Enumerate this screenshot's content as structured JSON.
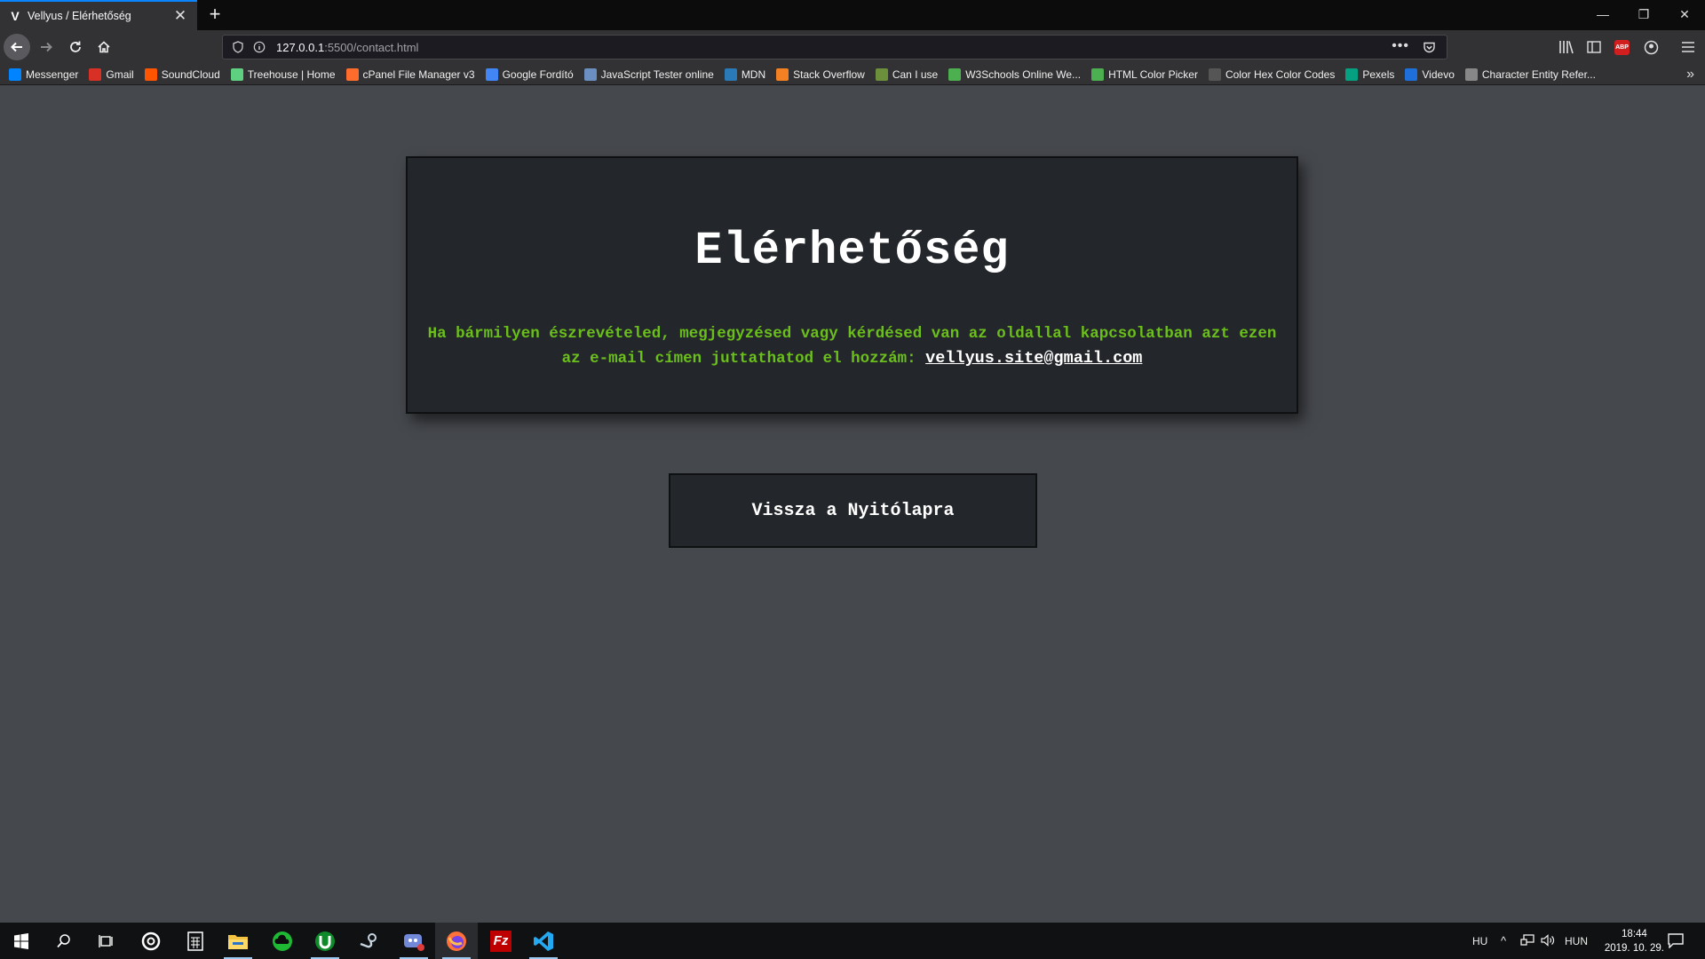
{
  "browser": {
    "tab": {
      "title": "Vellyus / Elérhetőség",
      "favicon": "V"
    },
    "url": {
      "host": "127.0.0.1",
      "rest": ":5500/contact.html"
    },
    "bookmarks": [
      {
        "label": "Messenger",
        "icon": "messenger-icon",
        "color": "#0084ff"
      },
      {
        "label": "Gmail",
        "icon": "gmail-icon",
        "color": "#d93025"
      },
      {
        "label": "SoundCloud",
        "icon": "soundcloud-icon",
        "color": "#ff5500"
      },
      {
        "label": "Treehouse | Home",
        "icon": "treehouse-icon",
        "color": "#5fcf80"
      },
      {
        "label": "cPanel File Manager v3",
        "icon": "cpanel-icon",
        "color": "#ff6c2c"
      },
      {
        "label": "Google Fordító",
        "icon": "google-translate-icon",
        "color": "#4285f4"
      },
      {
        "label": "JavaScript Tester online",
        "icon": "grid-icon",
        "color": "#6a8fc0"
      },
      {
        "label": "MDN",
        "icon": "mdn-icon",
        "color": "#2a7ab8"
      },
      {
        "label": "Stack Overflow",
        "icon": "stackoverflow-icon",
        "color": "#f48024"
      },
      {
        "label": "Can I use",
        "icon": "caniuse-icon",
        "color": "#6b8f3a"
      },
      {
        "label": "W3Schools Online We...",
        "icon": "w3schools-icon",
        "color": "#4caf50"
      },
      {
        "label": "HTML Color Picker",
        "icon": "w3schools-icon",
        "color": "#4caf50"
      },
      {
        "label": "Color Hex Color Codes",
        "icon": "colorhex-icon",
        "color": "#555555"
      },
      {
        "label": "Pexels",
        "icon": "pexels-icon",
        "color": "#05a081"
      },
      {
        "label": "Videvo",
        "icon": "videvo-icon",
        "color": "#1e6fd9"
      },
      {
        "label": "Character Entity Refer...",
        "icon": "globe-icon",
        "color": "#888888"
      }
    ]
  },
  "page": {
    "title": "Elérhetőség",
    "message": "Ha bármilyen észrevételed, megjegyzésed vagy kérdésed van az oldallal kapcsolatban azt ezen az e-mail címen juttathatod el hozzám:",
    "email": "vellyus.site@gmail.com",
    "back_button": "Vissza a Nyitólapra",
    "colors": {
      "background": "#45484d",
      "card": "#23262a",
      "text_accent": "#6bbf1b"
    }
  },
  "taskbar": {
    "language_short": "HU",
    "language": "HUN",
    "time": "18:44",
    "date": "2019. 10. 29."
  }
}
